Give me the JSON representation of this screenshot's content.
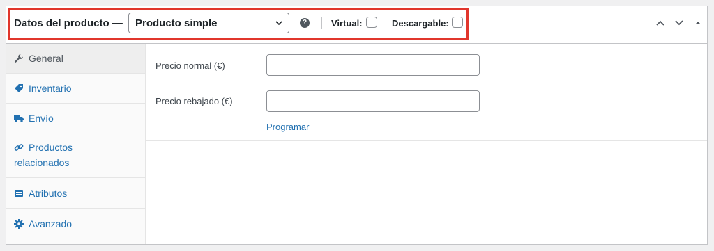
{
  "header": {
    "title": "Datos del producto —",
    "product_type": "Producto simple",
    "help_glyph": "?",
    "virtual_label": "Virtual:",
    "downloadable_label": "Descargable:",
    "icons": [
      "chevron-up-icon",
      "chevron-down-icon",
      "triangle-up-icon"
    ]
  },
  "tabs": [
    {
      "label": "General",
      "icon": "wrench-icon",
      "active": true
    },
    {
      "label": "Inventario",
      "icon": "tag-icon",
      "active": false
    },
    {
      "label": "Envío",
      "icon": "truck-icon",
      "active": false
    },
    {
      "label_line1": "Productos",
      "label_line2": "relacionados",
      "icon": "link-icon",
      "active": false
    },
    {
      "label": "Atributos",
      "icon": "list-icon",
      "active": false
    },
    {
      "label": "Avanzado",
      "icon": "gear-icon",
      "active": false
    }
  ],
  "general": {
    "regular_price_label": "Precio normal (€)",
    "regular_price_value": "",
    "sale_price_label": "Precio rebajado (€)",
    "sale_price_value": "",
    "schedule_link": "Programar"
  },
  "colors": {
    "highlight": "#e1362c",
    "link": "#2271b1"
  }
}
